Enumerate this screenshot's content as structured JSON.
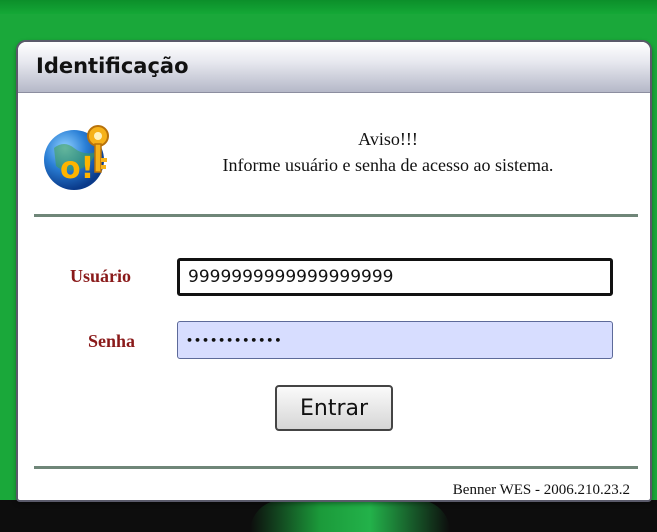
{
  "dialog": {
    "title": "Identificação",
    "notice_heading": "Aviso!!!",
    "notice_text": "Informe usuário e senha de acesso ao sistema.",
    "icon": "info-globe-key-icon"
  },
  "form": {
    "user_label": "Usuário",
    "user_value": "9999999999999999999",
    "password_label": "Senha",
    "password_value": "••••••••••••",
    "submit_label": "Entrar"
  },
  "footer": {
    "version": "Benner WES - 2006.210.23.2"
  },
  "colors": {
    "background": "#1aa83a",
    "label": "#8a1a1a",
    "password_field": "#d7ddff"
  }
}
